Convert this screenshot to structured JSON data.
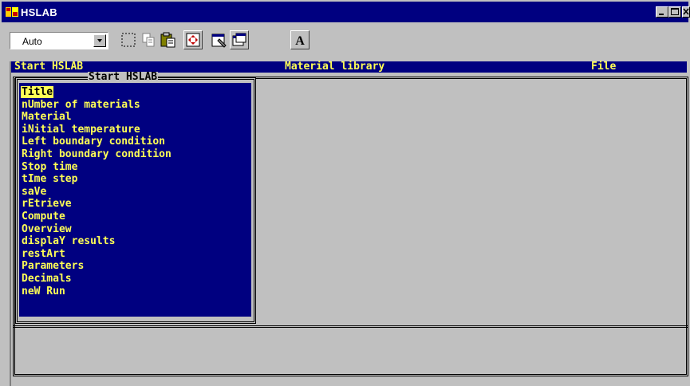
{
  "window": {
    "title": "HSLAB",
    "app_icon": "hslab-app-icon",
    "controls": [
      "minimize-icon",
      "maximize-icon",
      "close-icon"
    ]
  },
  "toolbar": {
    "font_size_value": "Auto",
    "tools": [
      "mark-icon",
      "copy-icon",
      "paste-icon",
      "fullscreen-icon",
      "properties-icon",
      "background-icon",
      "font-icon"
    ],
    "font_tool_label": "A"
  },
  "menubar": {
    "items": [
      "Start HSLAB",
      "Material library",
      "File"
    ]
  },
  "panel": {
    "title": "Start HSLAB",
    "selected_index": 0,
    "items": [
      "Title",
      "nUmber of materials",
      "Material",
      "iNitial temperature",
      "Left boundary condition",
      "Right boundary condition",
      "Stop time",
      "tIme step",
      "saVe",
      "rEtrieve",
      "Compute",
      "Overview",
      "displaY results",
      "restArt",
      "Parameters",
      "Decimals",
      "neW Run"
    ]
  },
  "colors": {
    "title_bar": "#000080",
    "console_bg": "#c0c0c0",
    "menu_bg": "#000080",
    "menu_text": "#ffff55",
    "highlight_bg": "#ffff55",
    "highlight_text": "#000000"
  }
}
